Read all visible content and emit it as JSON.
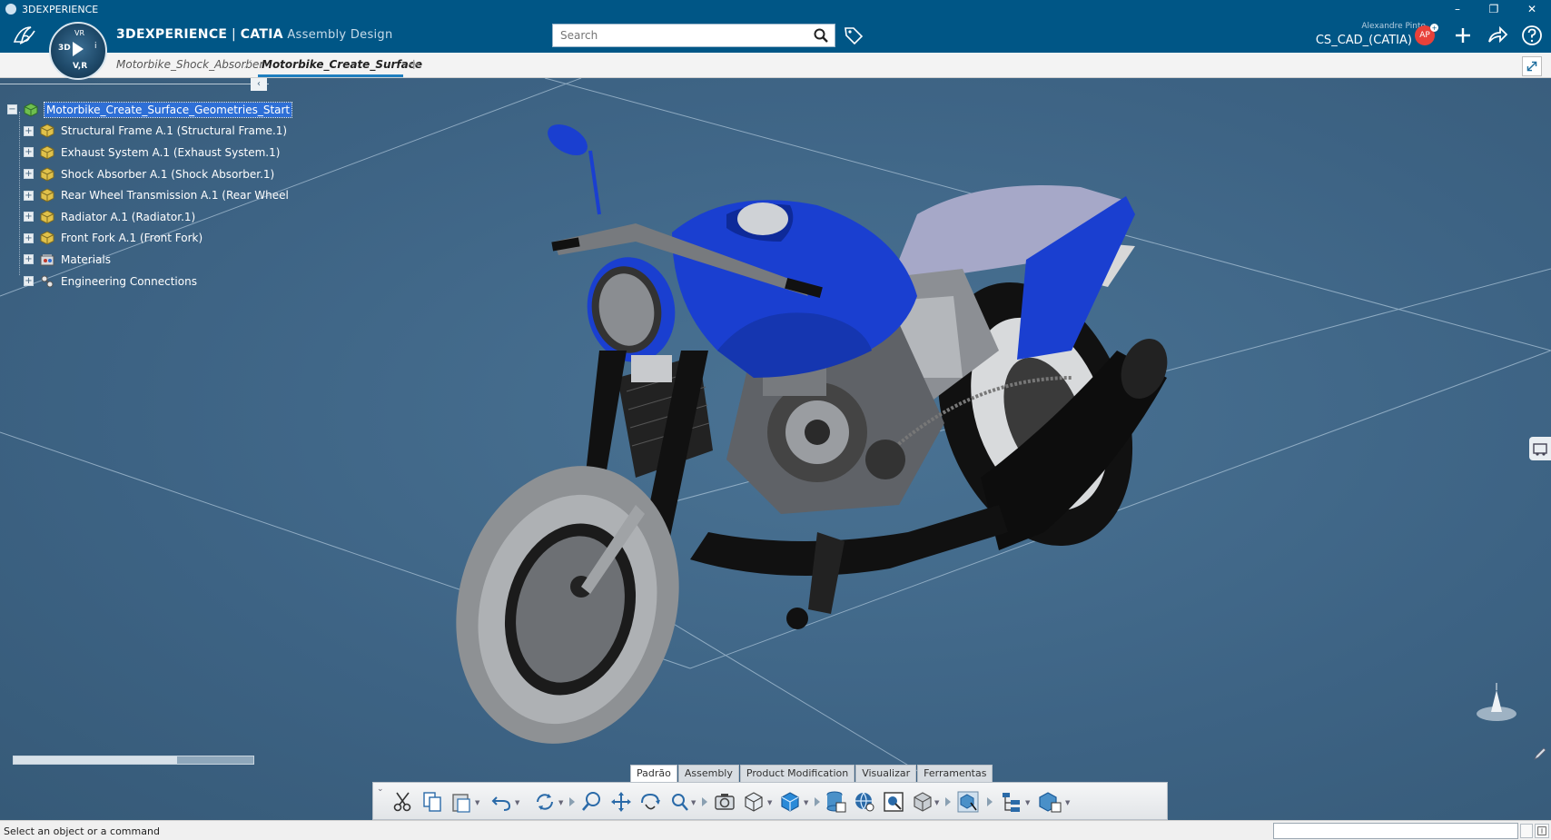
{
  "window": {
    "title": "3DEXPERIENCE",
    "min": "–",
    "restore": "❐",
    "close": "✕"
  },
  "compass": {
    "top": "VR",
    "left": "3D",
    "right": "i",
    "bottom": "V,R"
  },
  "header": {
    "brand_part1": "3DEXPERIENCE",
    "brand_sep": " | ",
    "brand_part2": "CATIA",
    "brand_part3": " Assembly Design",
    "search_placeholder": "Search",
    "user_name": "Alexandre Pinto",
    "user_role": "CS_CAD_(CATIA)",
    "avatar_initials": "AP",
    "avatar_badge": "+"
  },
  "tabs": {
    "items": [
      {
        "label": "Motorbike_Shock_Absorber"
      },
      {
        "label": "Motorbike_Create_Surface"
      }
    ],
    "add_label": "+"
  },
  "tree": {
    "collapse_label": "‹",
    "root": {
      "label": "Motorbike_Create_Surface_Geometries_Start"
    },
    "children": [
      {
        "label": "Structural Frame A.1 (Structural Frame.1)",
        "icon": "product-icon"
      },
      {
        "label": "Exhaust System A.1 (Exhaust System.1)",
        "icon": "product-icon"
      },
      {
        "label": "Shock Absorber A.1 (Shock Absorber.1)",
        "icon": "product-icon"
      },
      {
        "label": "Rear Wheel Transmission A.1 (Rear Wheel",
        "icon": "product-icon"
      },
      {
        "label": "Radiator A.1 (Radiator.1)",
        "icon": "product-icon"
      },
      {
        "label": "Front Fork A.1 (Front Fork)",
        "icon": "product-icon"
      },
      {
        "label": "Materials",
        "icon": "materials-icon"
      },
      {
        "label": "Engineering Connections",
        "icon": "engineering-connections-icon"
      }
    ],
    "expand_symbol": "+"
  },
  "section_tabs": [
    {
      "label": "Padrão",
      "active": true
    },
    {
      "label": "Assembly",
      "active": false
    },
    {
      "label": "Product Modification",
      "active": false
    },
    {
      "label": "Visualizar",
      "active": false
    },
    {
      "label": "Ferramentas",
      "active": false
    }
  ],
  "actionbar": {
    "tools": [
      "cut-icon",
      "copy-icon",
      "paste-icon",
      "undo-icon",
      "update-icon",
      "zoom-icon",
      "pan-icon",
      "rotate-icon",
      "fit-all-icon",
      "capture-icon",
      "view-orientation-icon",
      "render-style-icon",
      "save-database-icon",
      "global-icon",
      "search-3d-icon",
      "shading-icon",
      "insert-product-icon",
      "tree-reorder-icon",
      "assembly-constraint-icon"
    ]
  },
  "status": {
    "text": "Select an object or a command"
  },
  "colors": {
    "header_bg": "#005686",
    "viewport_bg": "#3d6384",
    "selection": "#2e6fd6",
    "bike_blue": "#1a3fd0"
  }
}
